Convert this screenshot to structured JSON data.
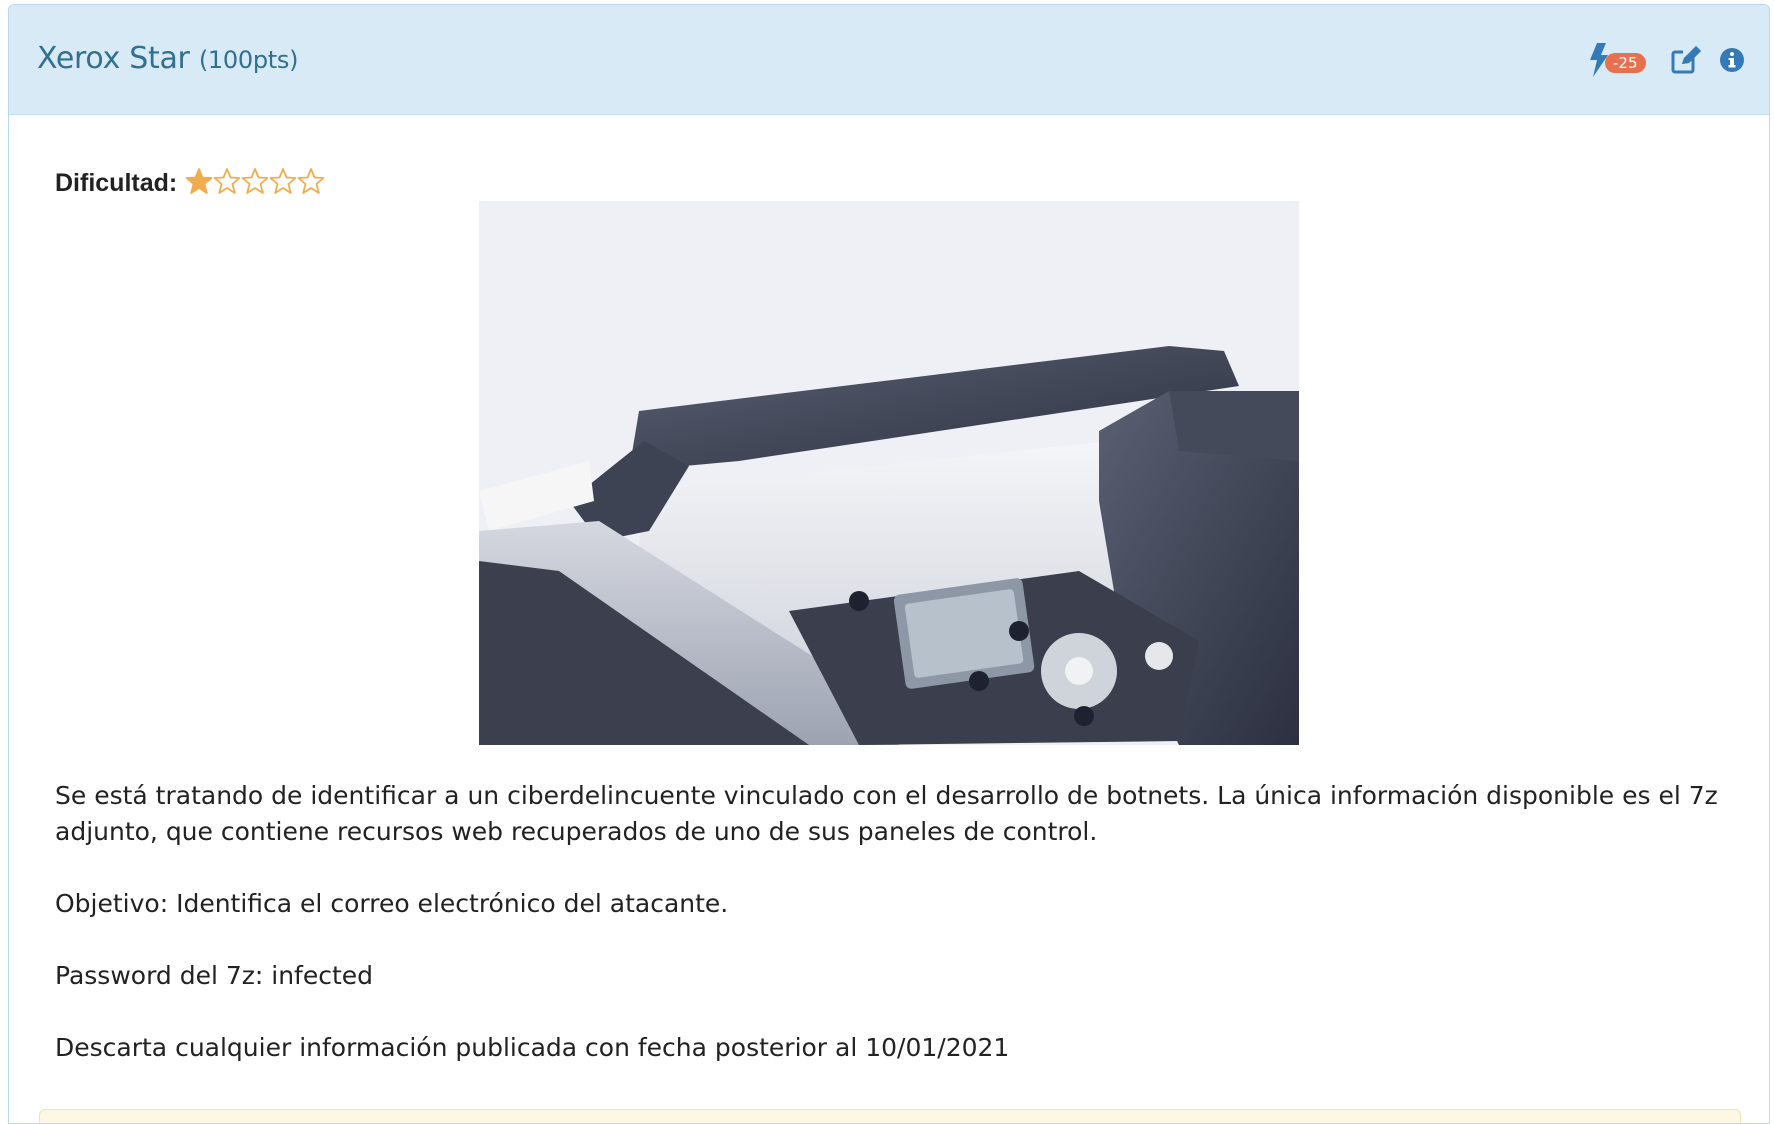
{
  "challenge": {
    "title": "Xerox Star",
    "points": "(100pts)",
    "penalty_badge": "-25",
    "icons": {
      "penalty": "bolt-icon",
      "edit": "edit-icon",
      "info": "info-icon"
    }
  },
  "difficulty": {
    "label": "Dificultad:",
    "rating": 1,
    "max": 5,
    "star_color": "#f0ad4e"
  },
  "image": {
    "subject": "wide-format printer photo"
  },
  "description": {
    "paragraphs": [
      "Se está tratando de identificar a un ciberdelincuente vinculado con el desarrollo de botnets. La única información disponible es el 7z adjunto, que contiene recursos web recuperados de uno de sus paneles de control.",
      "Objetivo: Identifica el correo electrónico del atacante.",
      "Password del 7z: infected",
      "Descarta cualquier información publicada con fecha posterior al 10/01/2021"
    ]
  },
  "colors": {
    "heading_bg": "#d9eaf7",
    "title_color": "#31708f",
    "badge_bg": "#e8704e",
    "icon_color": "#337ab7"
  }
}
